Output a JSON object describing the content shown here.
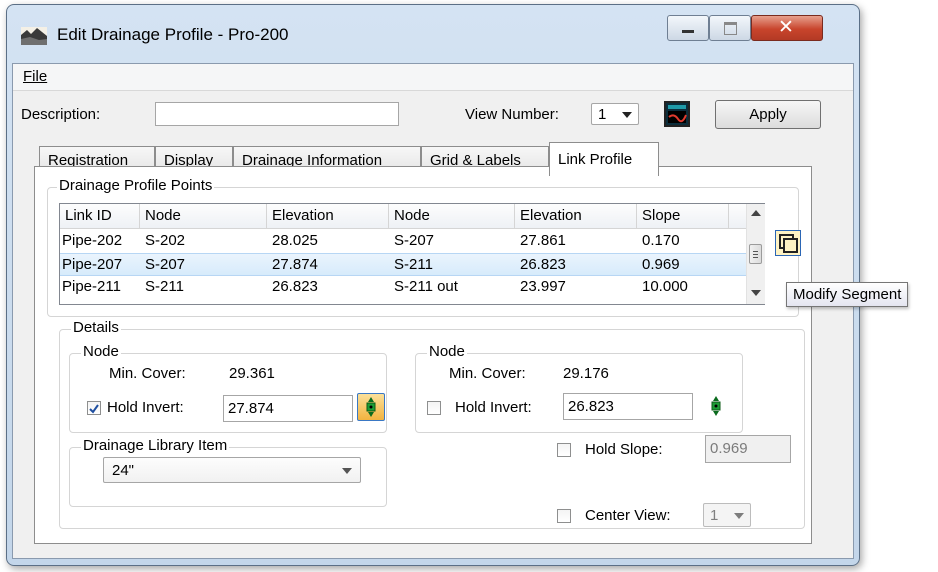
{
  "window": {
    "title": "Edit Drainage Profile - Pro-200",
    "colors": {
      "frame": "#c8d9ec",
      "close_button": "#c8442c"
    }
  },
  "menu": {
    "file": "File"
  },
  "top_controls": {
    "description_label": "Description:",
    "description_value": "",
    "view_number_label": "View Number:",
    "view_number_value": "1",
    "apply_label": "Apply"
  },
  "tabs": [
    {
      "label": "Registration",
      "active": false
    },
    {
      "label": "Display",
      "active": false
    },
    {
      "label": "Drainage Information",
      "active": false
    },
    {
      "label": "Grid & Labels",
      "active": false
    },
    {
      "label": "Link Profile",
      "active": true
    }
  ],
  "profile_points": {
    "group_title": "Drainage Profile Points",
    "columns": [
      "Link ID",
      "Node",
      "Elevation",
      "Node",
      "Elevation",
      "Slope"
    ],
    "rows": [
      [
        "Pipe-202",
        "S-202",
        "28.025",
        "S-207",
        "27.861",
        "0.170"
      ],
      [
        "Pipe-207",
        "S-207",
        "27.874",
        "S-211",
        "26.823",
        "0.969"
      ],
      [
        "Pipe-211",
        "S-211",
        "26.823",
        "S-211 out",
        "23.997",
        "10.000"
      ]
    ],
    "selected_row": 1
  },
  "tooltip": {
    "text": "Modify Segment"
  },
  "details": {
    "group_title": "Details",
    "node_left": {
      "group_title": "Node",
      "min_cover_label": "Min. Cover:",
      "min_cover_value": "29.361",
      "hold_invert_label": "Hold Invert:",
      "hold_invert_checked": true,
      "hold_invert_value": "27.874"
    },
    "node_right": {
      "group_title": "Node",
      "min_cover_label": "Min. Cover:",
      "min_cover_value": "29.176",
      "hold_invert_label": "Hold Invert:",
      "hold_invert_checked": false,
      "hold_invert_value": "26.823"
    },
    "library": {
      "group_title": "Drainage Library Item",
      "selected": "24\""
    },
    "hold_slope_label": "Hold Slope:",
    "hold_slope_checked": false,
    "hold_slope_value": "0.969",
    "center_view_label": "Center View:",
    "center_view_checked": false,
    "center_view_value": "1"
  },
  "icons": {
    "app": "drainage-app-icon",
    "view_picker": "view-select-icon",
    "locate_left": "locate-target-icon",
    "locate_right": "locate-target-icon",
    "modify_segment": "modify-segment-icon"
  }
}
